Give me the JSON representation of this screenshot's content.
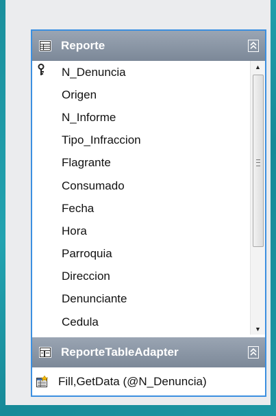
{
  "table": {
    "title": "Reporte",
    "columns": [
      {
        "label": "N_Denuncia",
        "primary_key": true
      },
      {
        "label": "Origen"
      },
      {
        "label": "N_Informe"
      },
      {
        "label": "Tipo_Infraccion"
      },
      {
        "label": "Flagrante"
      },
      {
        "label": "Consumado"
      },
      {
        "label": "Fecha"
      },
      {
        "label": "Hora"
      },
      {
        "label": "Parroquia"
      },
      {
        "label": "Direccion"
      },
      {
        "label": "Denunciante"
      },
      {
        "label": "Cedula"
      }
    ]
  },
  "adapter": {
    "title": "ReporteTableAdapter",
    "methods": [
      {
        "label": "Fill,GetData (@N_Denuncia)"
      }
    ]
  },
  "colors": {
    "selection_border": "#3b8fe0",
    "header_bg": "#8a96a6",
    "background": "#1a8f9c"
  },
  "icons": {
    "table": "datatable-icon",
    "key": "key-icon",
    "collapse": "collapse-chevron-icon",
    "adapter": "table-adapter-icon",
    "method": "query-method-icon"
  }
}
